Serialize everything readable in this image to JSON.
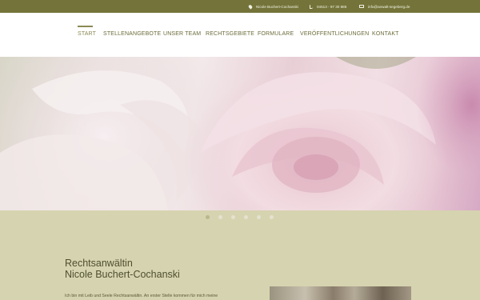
{
  "topbar": {
    "address": "Nicole Buchert-Cochanski",
    "phone": "04513 - 97 30 886",
    "email": "info@anwalt-segeberg.de"
  },
  "nav": {
    "items": [
      {
        "label": "Start",
        "active": true
      },
      {
        "label": "Stellenangebote",
        "active": false
      },
      {
        "label": "Unser Team",
        "active": false
      },
      {
        "label": "Rechtsgebiete",
        "active": false
      },
      {
        "label": "Formulare",
        "active": false
      },
      {
        "label": "Veröffentlichungen",
        "active": false
      },
      {
        "label": "Kontakt",
        "active": false
      }
    ]
  },
  "slider": {
    "slide_count": 6,
    "active_index": 0
  },
  "main": {
    "heading_line1": "Rechtsanwältin",
    "heading_line2": "Nicole Buchert-Cochanski",
    "intro": "Ich bin mit Leib und Seele Rechtsanwältin. An erster Stelle kommen für mich meine"
  },
  "colors": {
    "topbar": "#74743a",
    "nav_text": "#6b6b3a",
    "content_bg": "#d6d3b0",
    "heading": "#4e4e2e"
  }
}
